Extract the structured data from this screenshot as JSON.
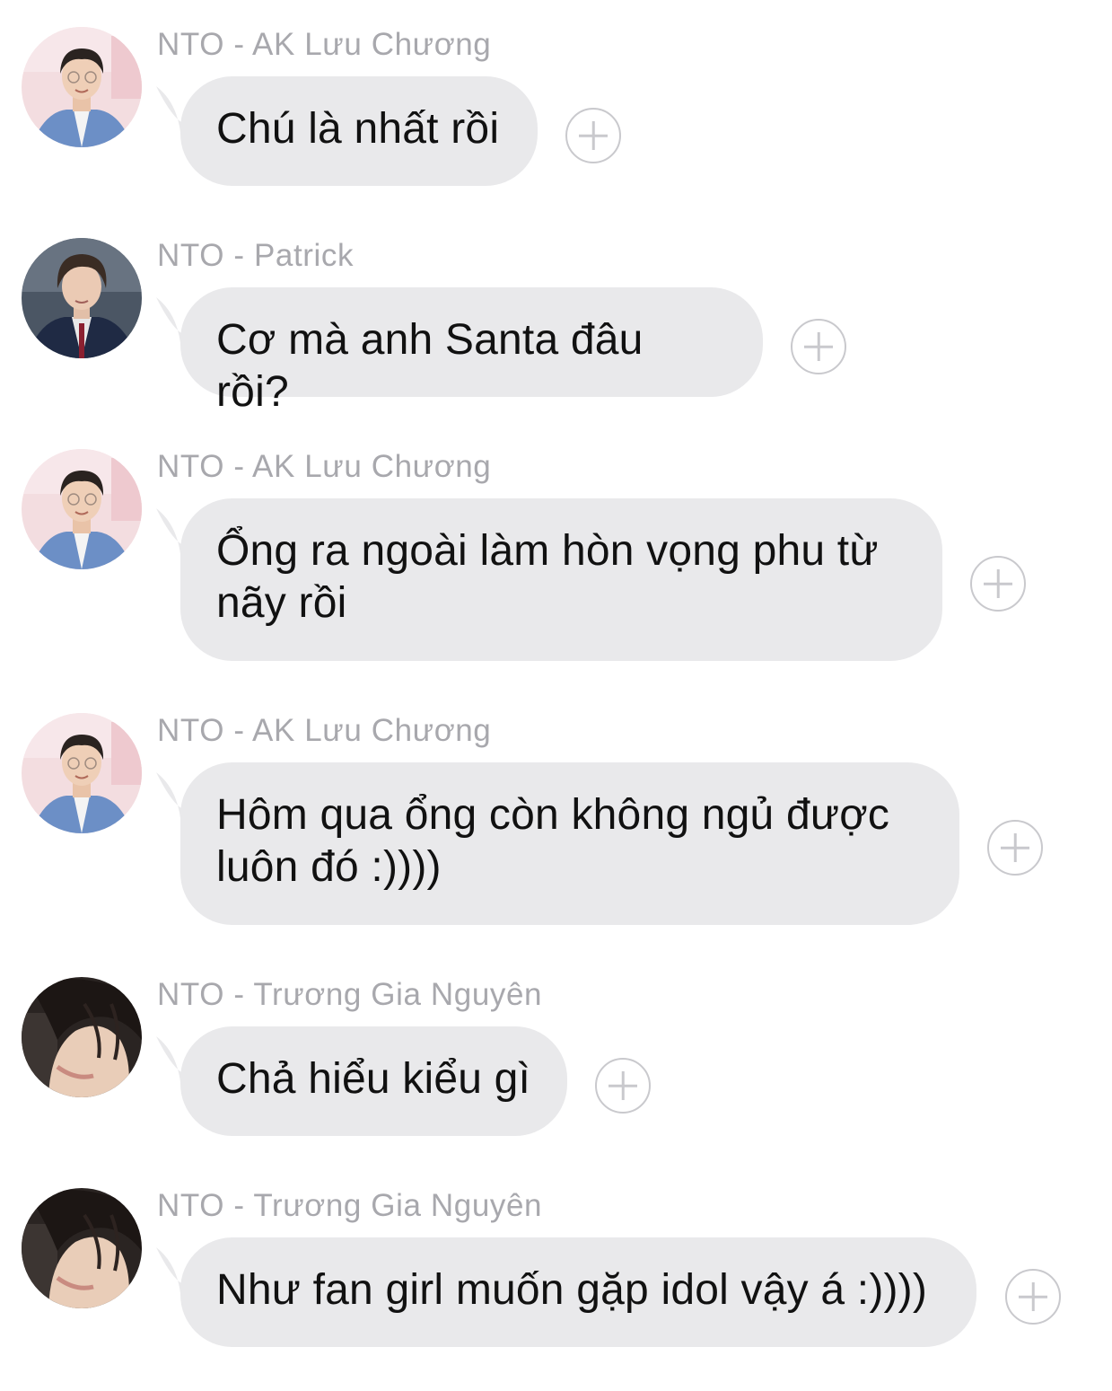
{
  "messages": [
    {
      "sender": "NTO - AK Lưu Chương",
      "avatar": "ak-luu-chuong-avatar",
      "text": "Chú là nhất rồi"
    },
    {
      "sender": "NTO - Patrick",
      "avatar": "patrick-avatar",
      "text": "Cơ mà anh Santa đâu rồi?"
    },
    {
      "sender": "NTO - AK Lưu Chương",
      "avatar": "ak-luu-chuong-avatar",
      "text": "Ổng ra ngoài làm hòn vọng phu từ nãy rồi"
    },
    {
      "sender": "NTO - AK Lưu Chương",
      "avatar": "ak-luu-chuong-avatar",
      "text": "Hôm qua ổng còn không ngủ được luôn đó :))))"
    },
    {
      "sender": "NTO - Trương Gia Nguyên",
      "avatar": "truong-gia-nguyen-avatar",
      "text": "Chả hiểu kiểu gì"
    },
    {
      "sender": "NTO - Trương Gia Nguyên",
      "avatar": "truong-gia-nguyen-avatar",
      "text": "Như fan girl muốn gặp idol vậy á :))))"
    }
  ],
  "colors": {
    "bubble": "#e9e9eb",
    "sender_text": "#a8a8ad",
    "message_text": "#111111",
    "add_icon": "#c9c9cd"
  },
  "icons": {
    "add_reaction": "plus-circle-icon"
  }
}
